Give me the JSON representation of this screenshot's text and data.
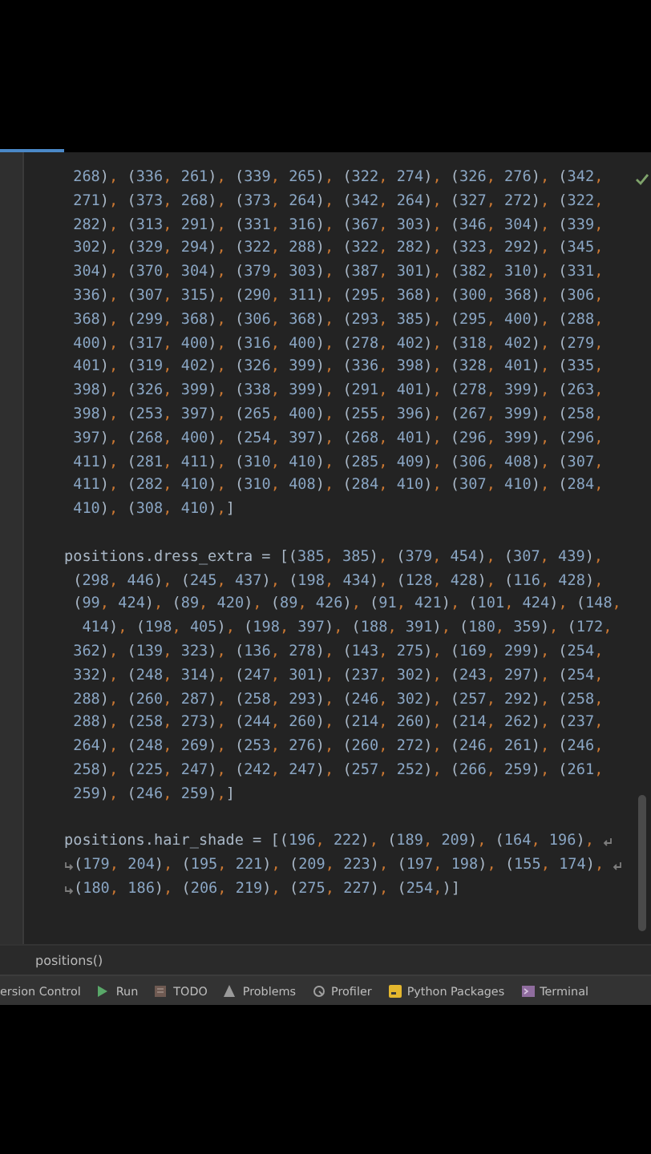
{
  "editor": {
    "blocks": [
      {
        "soft_wrapped": false,
        "lines": [
          " 268), (336, 261), (339, 265), (322, 274), (326, 276), (342,",
          " 271), (373, 268), (373, 264), (342, 264), (327, 272), (322,",
          " 282), (313, 291), (331, 316), (367, 303), (346, 304), (339,",
          " 302), (329, 294), (322, 288), (322, 282), (323, 292), (345,",
          " 304), (370, 304), (379, 303), (387, 301), (382, 310), (331,",
          " 336), (307, 315), (290, 311), (295, 368), (300, 368), (306,",
          " 368), (299, 368), (306, 368), (293, 385), (295, 400), (288,",
          " 400), (317, 400), (316, 400), (278, 402), (318, 402), (279,",
          " 401), (319, 402), (326, 399), (336, 398), (328, 401), (335,",
          " 398), (326, 399), (338, 399), (291, 401), (278, 399), (263,",
          " 398), (253, 397), (265, 400), (255, 396), (267, 399), (258,",
          " 397), (268, 400), (254, 397), (268, 401), (296, 399), (296,",
          " 411), (281, 411), (310, 410), (285, 409), (306, 408), (307,",
          " 411), (282, 410), (310, 408), (284, 410), (307, 410), (284,",
          " 410), (308, 410),]"
        ]
      },
      {
        "soft_wrapped": false,
        "lines": [
          "positions.dress_extra = [(385, 385), (379, 454), (307, 439),",
          " (298, 446), (245, 437), (198, 434), (128, 428), (116, 428),",
          " (99, 424), (89, 420), (89, 426), (91, 421), (101, 424), (148,",
          "  414), (198, 405), (198, 397), (188, 391), (180, 359), (172,",
          " 362), (139, 323), (136, 278), (143, 275), (169, 299), (254,",
          " 332), (248, 314), (247, 301), (237, 302), (243, 297), (254,",
          " 288), (260, 287), (258, 293), (246, 302), (257, 292), (258,",
          " 288), (258, 273), (244, 260), (214, 260), (214, 262), (237,",
          " 264), (248, 269), (253, 276), (260, 272), (246, 261), (246,",
          " 258), (225, 247), (242, 247), (257, 252), (266, 259), (261,",
          " 259), (246, 259),]"
        ]
      },
      {
        "soft_wrapped": true,
        "lines": [
          "positions.hair_shade = [(196, 222), (189, 209), (164, 196), ",
          "(179, 204), (195, 221), (209, 223), (197, 198), (155, 174), ",
          "(180, 186), (206, 219), (275, 227), (254,)]"
        ]
      }
    ]
  },
  "breadcrumb": "positions()",
  "tool_windows": [
    {
      "label": "ersion Control",
      "kind": "plain"
    },
    {
      "label": "Run",
      "kind": "run"
    },
    {
      "label": "TODO",
      "kind": "todo"
    },
    {
      "label": "Problems",
      "kind": "problems"
    },
    {
      "label": "Profiler",
      "kind": "profiler"
    },
    {
      "label": "Python Packages",
      "kind": "packages"
    },
    {
      "label": "Terminal",
      "kind": "terminal"
    }
  ]
}
